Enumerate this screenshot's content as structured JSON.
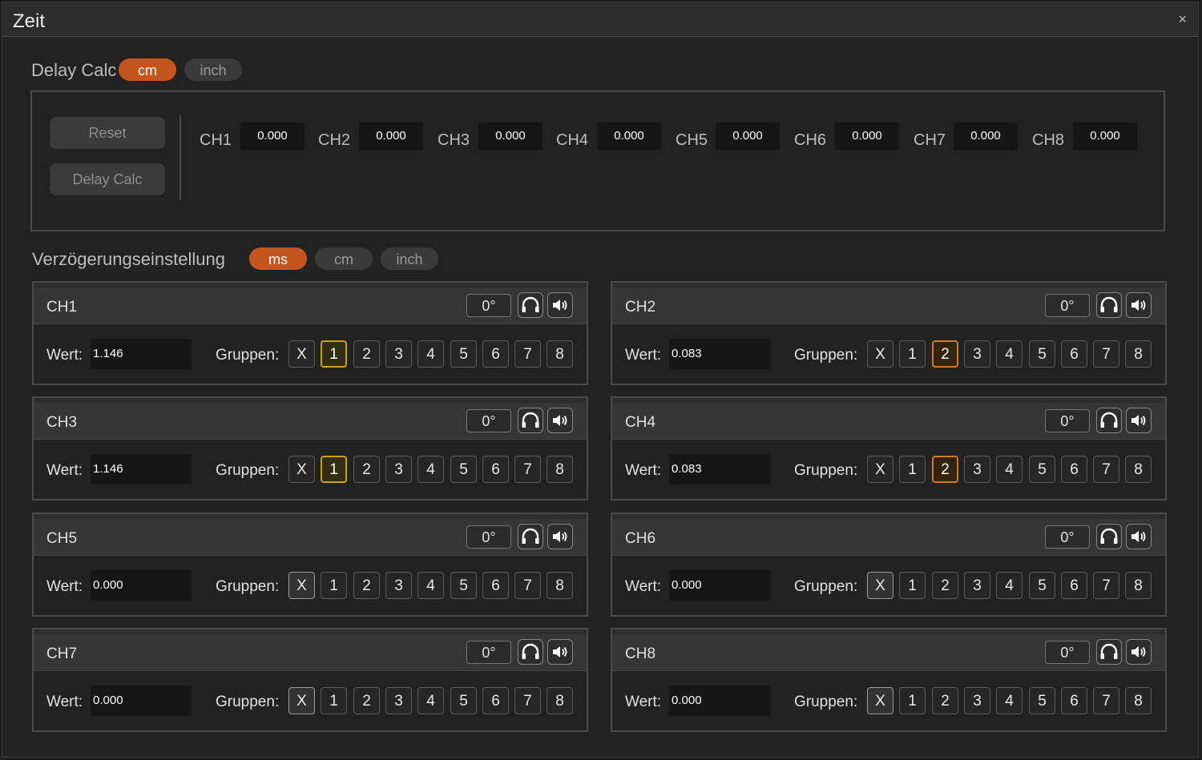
{
  "window": {
    "title": "Zeit",
    "close_glyph": "×"
  },
  "delay_calc": {
    "label": "Delay Calc",
    "units": [
      {
        "label": "cm",
        "active": true
      },
      {
        "label": "inch",
        "active": false
      }
    ],
    "reset_label": "Reset",
    "calc_label": "Delay Calc",
    "channels": [
      {
        "label": "CH1",
        "value": "0.000"
      },
      {
        "label": "CH2",
        "value": "0.000"
      },
      {
        "label": "CH3",
        "value": "0.000"
      },
      {
        "label": "CH4",
        "value": "0.000"
      },
      {
        "label": "CH5",
        "value": "0.000"
      },
      {
        "label": "CH6",
        "value": "0.000"
      },
      {
        "label": "CH7",
        "value": "0.000"
      },
      {
        "label": "CH8",
        "value": "0.000"
      }
    ]
  },
  "delay_setting": {
    "label": "Verzögerungseinstellung",
    "units": [
      {
        "label": "ms",
        "active": true
      },
      {
        "label": "cm",
        "active": false
      },
      {
        "label": "inch",
        "active": false
      }
    ],
    "wert_label": "Wert:",
    "gruppen_label": "Gruppen:",
    "group_buttons": [
      "X",
      "1",
      "2",
      "3",
      "4",
      "5",
      "6",
      "7",
      "8"
    ],
    "channels": [
      {
        "name": "CH1",
        "phase": "0°",
        "value": "1.146",
        "selected_group": "1"
      },
      {
        "name": "CH2",
        "phase": "0°",
        "value": "0.083",
        "selected_group": "2"
      },
      {
        "name": "CH3",
        "phase": "0°",
        "value": "1.146",
        "selected_group": "1"
      },
      {
        "name": "CH4",
        "phase": "0°",
        "value": "0.083",
        "selected_group": "2"
      },
      {
        "name": "CH5",
        "phase": "0°",
        "value": "0.000",
        "selected_group": "X"
      },
      {
        "name": "CH6",
        "phase": "0°",
        "value": "0.000",
        "selected_group": "X"
      },
      {
        "name": "CH7",
        "phase": "0°",
        "value": "0.000",
        "selected_group": "X"
      },
      {
        "name": "CH8",
        "phase": "0°",
        "value": "0.000",
        "selected_group": "X"
      }
    ]
  },
  "colors": {
    "accent_orange": "#c4551d",
    "group_1_highlight": "#c9a21b",
    "group_2_highlight": "#d07a22"
  },
  "icons": {
    "mute": "headphones-icon",
    "solo": "speaker-icon"
  }
}
